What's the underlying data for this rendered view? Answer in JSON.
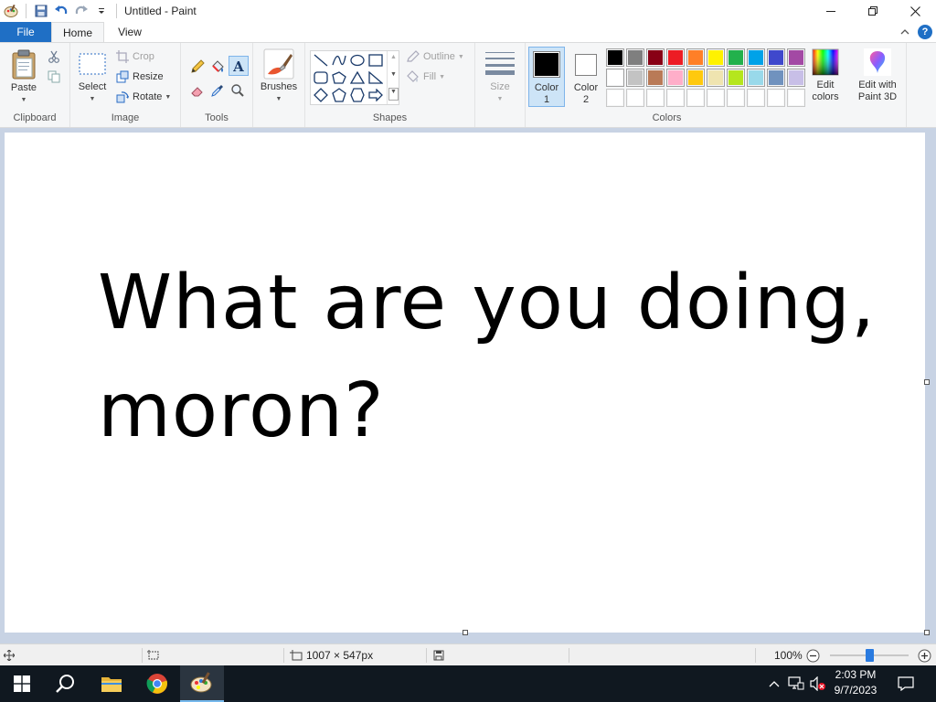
{
  "window": {
    "title": "Untitled - Paint"
  },
  "tabs": {
    "file": "File",
    "home": "Home",
    "view": "View"
  },
  "ribbon": {
    "clipboard": {
      "label": "Clipboard",
      "paste": "Paste"
    },
    "image": {
      "label": "Image",
      "select": "Select",
      "crop": "Crop",
      "resize": "Resize",
      "rotate": "Rotate"
    },
    "tools": {
      "label": "Tools"
    },
    "brushes": {
      "label": "Brushes"
    },
    "shapes": {
      "label": "Shapes",
      "outline": "Outline",
      "fill": "Fill"
    },
    "size": {
      "label": "Size"
    },
    "colors": {
      "label": "Colors",
      "color1_line1": "Color",
      "color1_line2": "1",
      "color2_line1": "Color",
      "color2_line2": "2",
      "edit_line1": "Edit",
      "edit_line2": "colors",
      "paint3d_line1": "Edit with",
      "paint3d_line2": "Paint 3D",
      "color1_value": "#000000",
      "color2_value": "#ffffff",
      "palette_row1": [
        "#000000",
        "#7f7f7f",
        "#880015",
        "#ed1c24",
        "#ff7f27",
        "#fff200",
        "#22b14c",
        "#00a2e8",
        "#3f48cc",
        "#a349a4"
      ],
      "palette_row2": [
        "#ffffff",
        "#c3c3c3",
        "#b97a57",
        "#ffaec9",
        "#ffc90e",
        "#efe4b0",
        "#b5e61d",
        "#99d9ea",
        "#7092be",
        "#c8bfe7"
      ],
      "palette_row3": [
        "#ffffff",
        "#ffffff",
        "#ffffff",
        "#ffffff",
        "#ffffff",
        "#ffffff",
        "#ffffff",
        "#ffffff",
        "#ffffff",
        "#ffffff"
      ]
    }
  },
  "canvas": {
    "line1": "What are you doing,",
    "line2": "moron?"
  },
  "status": {
    "dimensions": "1007 × 547px",
    "zoom": "100%",
    "zoom_level": 0.5
  },
  "taskbar": {
    "time": "2:03 PM",
    "date": "9/7/2023"
  }
}
